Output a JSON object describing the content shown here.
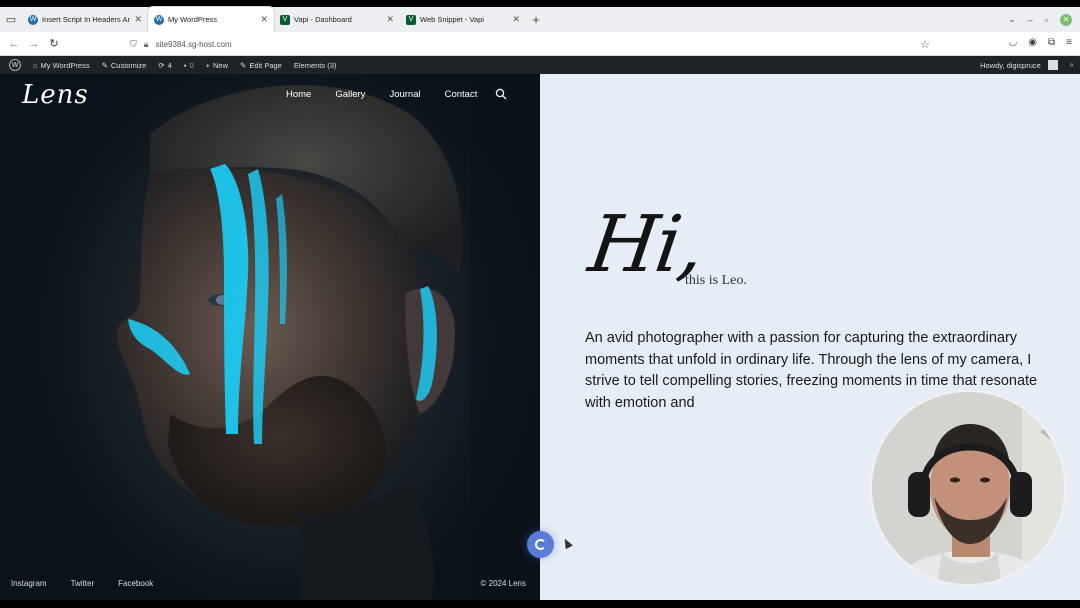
{
  "browser": {
    "tabs": [
      {
        "title": "Insert Script In Headers And",
        "favicon": "wordpress-icon",
        "active": false
      },
      {
        "title": "My WordPress",
        "favicon": "wordpress-icon",
        "active": true
      },
      {
        "title": "Vapi - Dashboard",
        "favicon": "vapi-icon",
        "active": false
      },
      {
        "title": "Web Snippet - Vapi",
        "favicon": "vapi-icon",
        "active": false
      }
    ],
    "url": "site9384.sg-host.com"
  },
  "wp_admin_bar": {
    "site_name": "My WordPress",
    "customize": "Customize",
    "updates_count": "4",
    "comments_count": "0",
    "new_label": "New",
    "edit_page": "Edit Page",
    "elements": "Elements (3)",
    "howdy": "Howdy, digispruce"
  },
  "site": {
    "logo": "Lens",
    "nav": [
      "Home",
      "Gallery",
      "Journal",
      "Contact"
    ],
    "social": [
      "Instagram",
      "Twitter",
      "Facebook"
    ],
    "copyright": "© 2024 Lens"
  },
  "hero_text": {
    "greeting": "Hi,",
    "intro": "this is Leo.",
    "bio": "An avid photographer with a passion for capturing the extraordinary moments that unfold in ordinary life. Through the lens of my camera, I strive to tell compelling stories, freezing moments in time that resonate with emotion and"
  },
  "colors": {
    "wp_bar": "#1d2327",
    "accent_cyan": "#1ec8f0",
    "content_bg": "#e6edf6",
    "loader": "#5a7bd8"
  }
}
